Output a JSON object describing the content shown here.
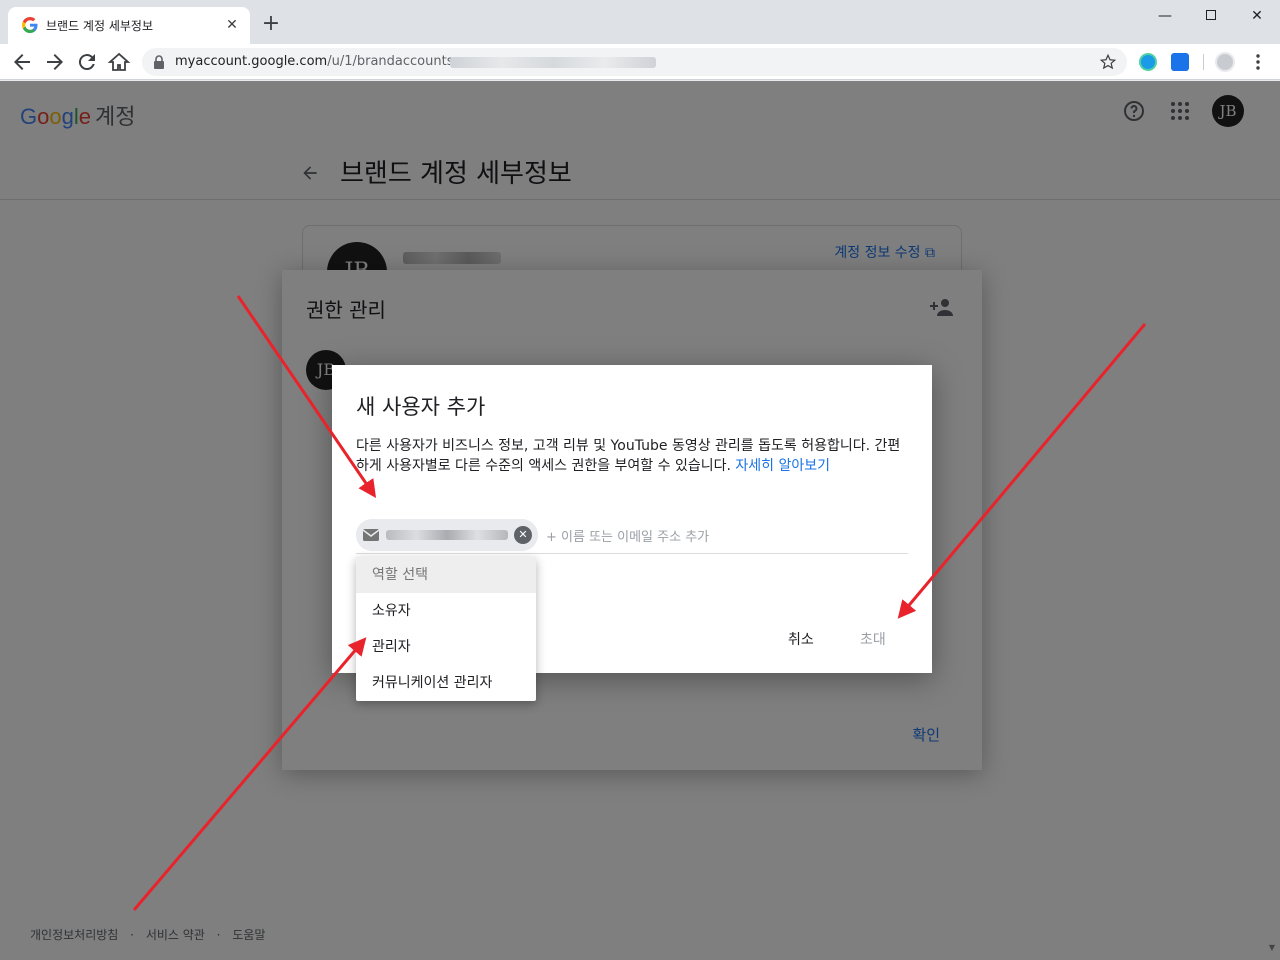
{
  "browser": {
    "tab_title": "브랜드 계정 세부정보",
    "new_tab": "+",
    "url_host": "myaccount.google.com",
    "url_path": "/u/1/brandaccounts"
  },
  "header": {
    "logo_letters": [
      "G",
      "o",
      "o",
      "g",
      "l",
      "e"
    ],
    "product": "계정",
    "avatar_initials": "JB"
  },
  "page": {
    "title": "브랜드 계정 세부정보",
    "card_avatar": "JB",
    "edit_link": "계정 정보 수정"
  },
  "permissions_dialog": {
    "title": "권한 관리",
    "owner_avatar": "JB",
    "confirm_label": "확인"
  },
  "add_user_dialog": {
    "title": "새 사용자 추가",
    "description": "다른 사용자가 비즈니스 정보, 고객 리뷰 및 YouTube 동영상 관리를 돕도록 허용합니다. 간편하게 사용자별로 다른 수준의 액세스 권한을 부여할 수 있습니다.",
    "learn_more": "자세히 알아보기",
    "input_placeholder": "+ 이름 또는 이메일 주소 추가",
    "cancel_label": "취소",
    "invite_label": "초대"
  },
  "role_menu": {
    "header": "역할 선택",
    "items": [
      "소유자",
      "관리자",
      "커뮤니케이션 관리자"
    ]
  },
  "footer": {
    "links": [
      "개인정보처리방침",
      "·",
      "서비스 약관",
      "·",
      "도움말"
    ]
  },
  "colors": {
    "link_blue": "#1a73e8",
    "annotation_red": "#e8232b"
  }
}
